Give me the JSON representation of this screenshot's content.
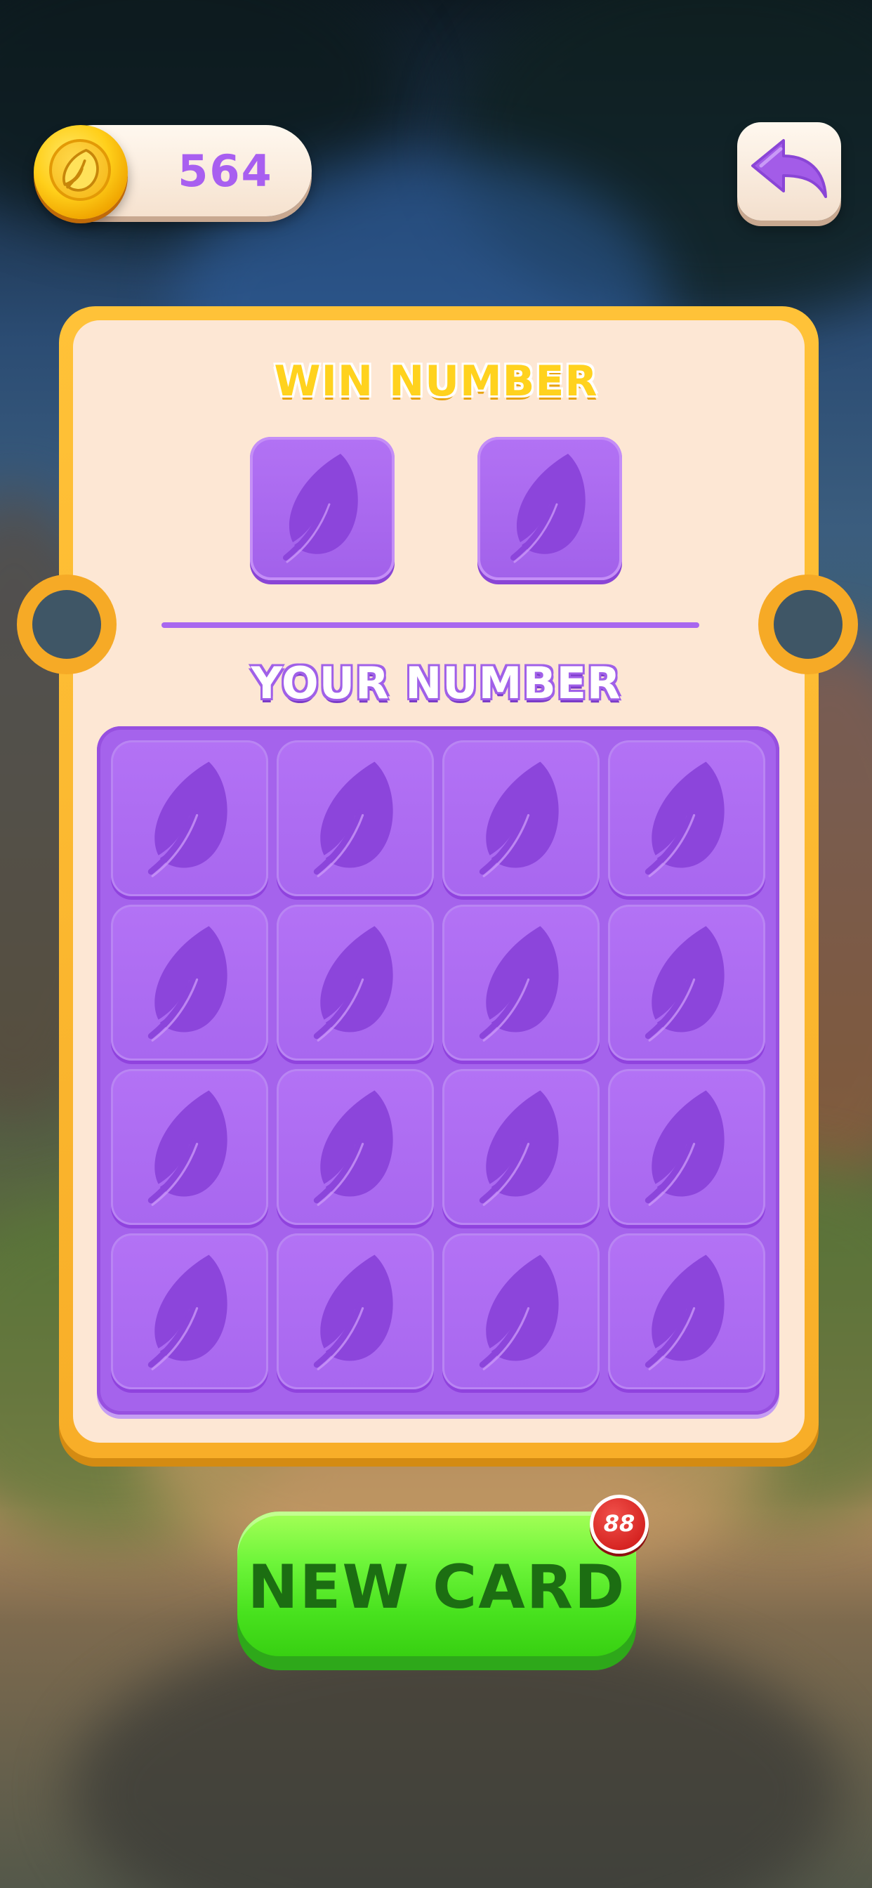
{
  "header": {
    "coins": "564",
    "coin_icon": "gold-leaf-coin-icon",
    "back_icon": "back-arrow-icon"
  },
  "card": {
    "win_title": "WIN NUMBER",
    "your_title": "YOUR NUMBER",
    "win_tiles": [
      {
        "icon": "leaf-icon",
        "state": "hidden"
      },
      {
        "icon": "leaf-icon",
        "state": "hidden"
      }
    ],
    "grid_rows": 4,
    "grid_cols": 4,
    "grid_cells": [
      "leaf-icon",
      "leaf-icon",
      "leaf-icon",
      "leaf-icon",
      "leaf-icon",
      "leaf-icon",
      "leaf-icon",
      "leaf-icon",
      "leaf-icon",
      "leaf-icon",
      "leaf-icon",
      "leaf-icon",
      "leaf-icon",
      "leaf-icon",
      "leaf-icon",
      "leaf-icon"
    ]
  },
  "new_card_button": {
    "label": "NEW CARD",
    "badge": "88"
  },
  "colors": {
    "accent_purple": "#a563ec",
    "card_gold": "#f8ae28",
    "button_green": "#48e21e",
    "badge_red": "#d4211f"
  }
}
